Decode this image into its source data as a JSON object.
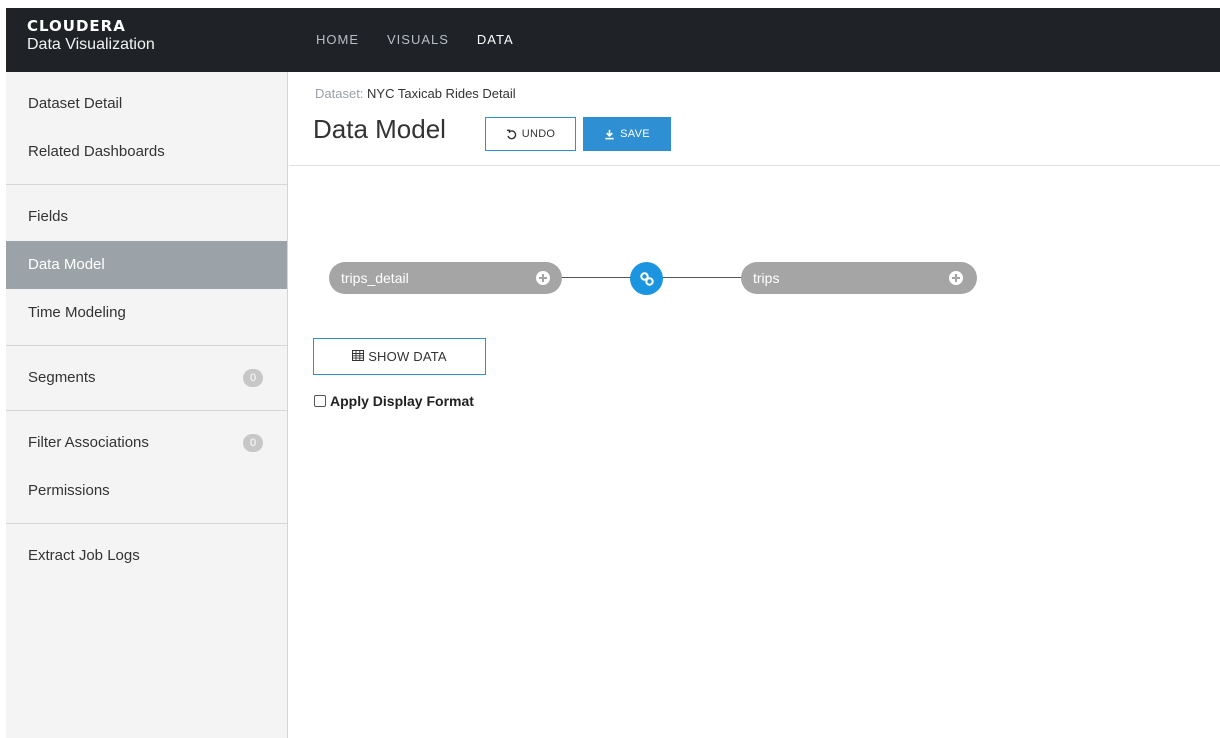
{
  "brand": {
    "name": "CLOUDERA",
    "product": "Data Visualization"
  },
  "nav": {
    "items": [
      {
        "label": "HOME"
      },
      {
        "label": "VISUALS"
      },
      {
        "label": "DATA"
      }
    ],
    "active": "DATA"
  },
  "sidebar": {
    "items": [
      {
        "label": "Dataset Detail"
      },
      {
        "label": "Related Dashboards"
      },
      {
        "label": "Fields"
      },
      {
        "label": "Data Model"
      },
      {
        "label": "Time Modeling"
      },
      {
        "label": "Segments",
        "badge": "0"
      },
      {
        "label": "Filter Associations",
        "badge": "0"
      },
      {
        "label": "Permissions"
      },
      {
        "label": "Extract Job Logs"
      }
    ],
    "active": "Data Model"
  },
  "breadcrumb": {
    "label": "Dataset:",
    "value": "NYC Taxicab Rides Detail"
  },
  "page": {
    "title": "Data Model",
    "undo_label": "UNDO",
    "save_label": "SAVE"
  },
  "model": {
    "left_table": "trips_detail",
    "right_table": "trips"
  },
  "actions": {
    "show_data_label": "SHOW DATA",
    "apply_display_format_label": "Apply Display Format",
    "apply_display_format_checked": false
  },
  "colors": {
    "topbar": "#1f2327",
    "accent": "#2f8fd3",
    "join": "#1b95e0",
    "pill": "#a5a5a5",
    "sidebar_active": "#9ca3a8"
  }
}
